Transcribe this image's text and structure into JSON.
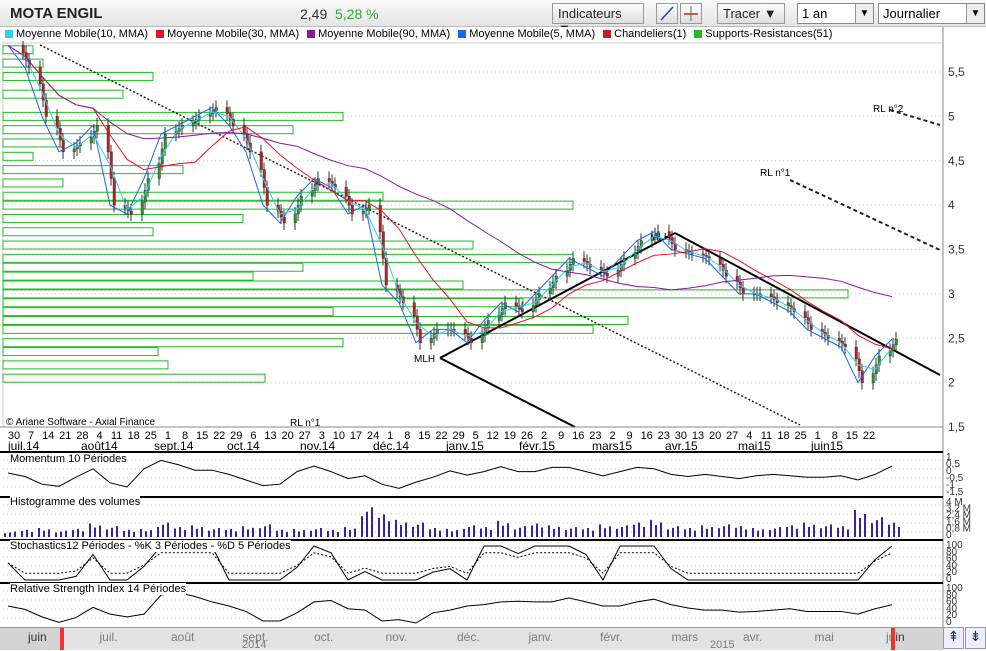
{
  "header": {
    "title": "MOTA ENGIL",
    "price": "2,49",
    "change": "5,28 %",
    "indicators_label": "Indicateurs",
    "draw_label": "Tracer",
    "period": "1 an",
    "interval": "Journalier"
  },
  "legend": [
    {
      "label": "Moyenne Mobile(10, MMA)",
      "color": "#33ccee"
    },
    {
      "label": "Moyenne Mobile(30, MMA)",
      "color": "#e8102a"
    },
    {
      "label": "Moyenne Mobile(90, MMA)",
      "color": "#8a1a9a"
    },
    {
      "label": "Moyenne Mobile(5, MMA)",
      "color": "#1a66ee"
    },
    {
      "label": "Chandeliers(1)",
      "color": "#c02020"
    },
    {
      "label": "Supports-Resistances(51)",
      "color": "#22bb22"
    }
  ],
  "copyright": "© Ariane Software - Axial Finance",
  "annotations": {
    "rl1": "RL n°1",
    "rl2": "RL n°2",
    "mlh": "MLH"
  },
  "panels": {
    "momentum": "Momentum 10 Périodes",
    "volume": "Histogramme des volumes",
    "stoch": "Stochastics12 Périodes  -  %K 3 Périodes  -  %D 5 Périodes",
    "rsi": "Relative Strength Index 14 Périodes"
  },
  "timeline": {
    "months": [
      "juin",
      "juil.",
      "août",
      "sept.",
      "oct.",
      "nov.",
      "déc.",
      "janv.",
      "févr.",
      "mars",
      "avr.",
      "mai",
      "juin"
    ],
    "years": [
      "2014",
      "2015"
    ]
  },
  "chart_data": {
    "type": "candlestick",
    "ylim": [
      1.5,
      5.9
    ],
    "yticks": [
      "1,5",
      "2",
      "2,5",
      "3",
      "3,5",
      "4",
      "4,5",
      "5",
      "5,5"
    ],
    "day_ticks": [
      "30",
      "7",
      "14",
      "21",
      "28",
      "4",
      "11",
      "18",
      "25",
      "1",
      "8",
      "15",
      "22",
      "29",
      "6",
      "13",
      "20",
      "27",
      "3",
      "10",
      "17",
      "24",
      "1",
      "8",
      "15",
      "22",
      "29",
      "5",
      "12",
      "19",
      "26",
      "2",
      "9",
      "16",
      "23",
      "2",
      "9",
      "16",
      "23",
      "30",
      "13",
      "20",
      "27",
      "4",
      "11",
      "18",
      "25",
      "1",
      "8",
      "15",
      "22"
    ],
    "month_ticks": [
      "juil.14",
      "août14",
      "sept.14",
      "oct.14",
      "nov.14",
      "déc.14",
      "janv.15",
      "févr.15",
      "mars15",
      "avr.15",
      "mai15",
      "juin15"
    ],
    "weekly_close": [
      5.8,
      5.55,
      5.0,
      4.6,
      4.7,
      4.9,
      4.0,
      3.9,
      4.3,
      4.8,
      4.9,
      5.0,
      5.1,
      4.9,
      4.6,
      4.0,
      3.8,
      4.1,
      4.3,
      4.2,
      3.9,
      4.0,
      3.1,
      2.9,
      2.45,
      2.6,
      2.6,
      2.45,
      2.7,
      2.9,
      2.8,
      3.0,
      3.2,
      3.4,
      3.3,
      3.2,
      3.4,
      3.6,
      3.7,
      3.5,
      3.45,
      3.4,
      3.2,
      3.0,
      3.0,
      2.9,
      2.8,
      2.6,
      2.5,
      2.4,
      2.0,
      2.3,
      2.49
    ],
    "weekly_volume": [
      0.6,
      0.8,
      1.0,
      0.7,
      0.9,
      1.5,
      1.2,
      0.8,
      0.9,
      1.6,
      1.1,
      1.3,
      1.0,
      0.9,
      1.2,
      1.4,
      0.8,
      0.9,
      1.0,
      0.8,
      1.1,
      3.3,
      2.5,
      1.9,
      1.6,
      1.0,
      0.9,
      1.3,
      1.1,
      1.8,
      1.2,
      1.5,
      1.3,
      1.1,
      1.0,
      1.4,
      1.3,
      1.6,
      1.9,
      1.2,
      1.0,
      1.3,
      1.4,
      1.2,
      1.0,
      1.1,
      1.3,
      1.6,
      1.4,
      1.2,
      3.0,
      2.2,
      1.6
    ],
    "support_resistance": [
      5.75,
      5.6,
      5.45,
      5.25,
      5.0,
      4.85,
      4.7,
      4.55,
      4.4,
      4.25,
      4.1,
      4.0,
      3.85,
      3.7,
      3.55,
      3.4,
      3.3,
      3.2,
      3.1,
      3.0,
      2.9,
      2.8,
      2.7,
      2.6,
      2.45,
      2.35,
      2.2,
      2.05
    ],
    "vol_ticks": [
      "4 M",
      "3,2 M",
      "2,4 M",
      "1,6 M",
      "0,8 M",
      "0"
    ],
    "osc_ticks": [
      "100",
      "80",
      "60",
      "40",
      "20",
      "0"
    ],
    "mom_ticks": [
      "1",
      "0,5",
      "0",
      "-0,5",
      "-1",
      "-1,5"
    ]
  }
}
